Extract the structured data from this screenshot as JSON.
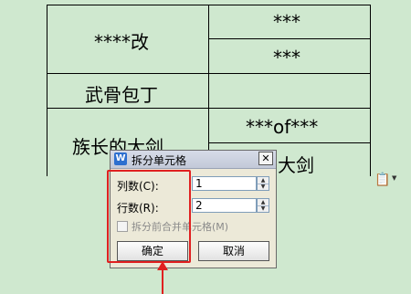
{
  "table": {
    "cells": {
      "r1_left": "****改",
      "r1_right_top": "***",
      "r1_right_bottom": "***",
      "r2_left": "武骨包丁",
      "r3_left": "族长的大剑",
      "r3_right_top": "***of***",
      "r3_right_bottom": "大剑"
    }
  },
  "dialog": {
    "title": "拆分单元格",
    "title_icon": "W",
    "close_glyph": "✕",
    "columns_label": "列数(C):",
    "columns_value": "1",
    "rows_label": "行数(R):",
    "rows_value": "2",
    "merge_checkbox_label": "拆分前合并单元格(M)",
    "merge_checked": false,
    "ok_label": "确定",
    "cancel_label": "取消"
  },
  "annotations": {
    "highlight_color": "#e02020",
    "arrow_color": "#e02020"
  },
  "icons": {
    "paste": "clipboard-icon",
    "dropdown": "chevron-down-icon"
  }
}
